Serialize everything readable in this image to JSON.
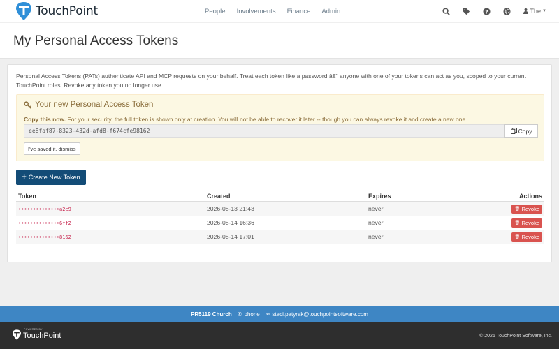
{
  "brand": {
    "name": "TouchPoint"
  },
  "nav": {
    "links": [
      "People",
      "Involvements",
      "Finance",
      "Admin"
    ],
    "icons": [
      "search-icon",
      "tag-icon",
      "help-icon",
      "globe-icon"
    ],
    "user_label": "The"
  },
  "page": {
    "title": "My Personal Access Tokens"
  },
  "intro": "Personal Access Tokens (PATs) authenticate API and MCP requests on your behalf. Treat each token like a password â€\" anyone with one of your tokens can act as you, scoped to your current TouchPoint roles. Revoke any token you no longer use.",
  "new_token": {
    "title": "Your new Personal Access Token",
    "copy_now": "Copy this now.",
    "message": "For your security, the full token is shown only at creation. You will not be able to recover it later -- though you can always revoke it and create a new one.",
    "value": "ee8faf87-8323-432d-afd8-f674cfe98162",
    "copy_label": "Copy",
    "dismiss_label": "I've saved it, dismiss"
  },
  "create_label": "Create New Token",
  "table": {
    "headers": {
      "token": "Token",
      "created": "Created",
      "expires": "Expires",
      "actions": "Actions"
    },
    "rows": [
      {
        "token": "••••••••••••••a2e9",
        "created": "2026-08-13 21:43",
        "expires": "never",
        "action": "Revoke"
      },
      {
        "token": "••••••••••••••6ff2",
        "created": "2026-08-14 16:36",
        "expires": "never",
        "action": "Revoke"
      },
      {
        "token": "••••••••••••••8162",
        "created": "2026-08-14 17:01",
        "expires": "never",
        "action": "Revoke"
      }
    ]
  },
  "footer": {
    "church": "PR5119 Church",
    "phone": "phone",
    "email": "staci.patyrak@touchpointsoftware.com",
    "powered_by": "POWERED BY",
    "logo_name": "TouchPoint",
    "copyright": "© 2026 TouchPoint Software, Inc."
  },
  "colors": {
    "brand_blue": "#134c77",
    "footer_blue": "#3e86c4",
    "danger": "#d9534f",
    "alert_bg": "#fcf8e3"
  }
}
